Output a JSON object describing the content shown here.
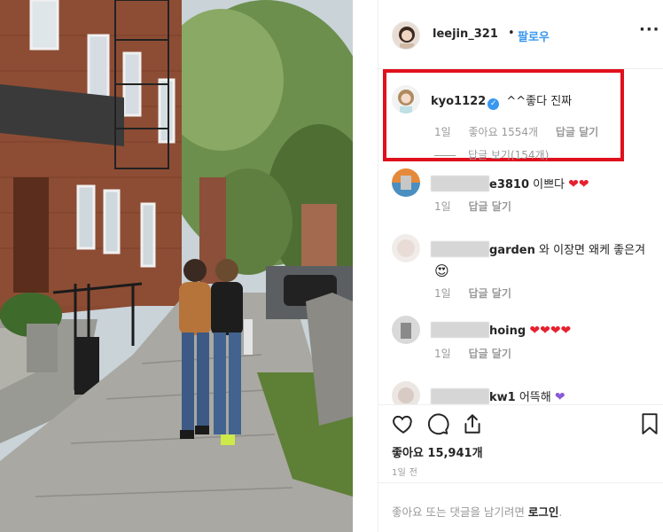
{
  "post": {
    "username": "leejin_321",
    "separator": "•",
    "follow_label": "팔로우",
    "more_icon": "more-dots-icon"
  },
  "comments": [
    {
      "username": "kyo1122",
      "verified": true,
      "text": "^^좋다 진짜",
      "time": "1일",
      "likes": "좋아요 1554개",
      "reply_label": "답글 달기",
      "view_replies": "답글 보기(154개)",
      "highlighted": true
    },
    {
      "username_suffix": "e3810",
      "text": "이쁘다",
      "time": "1일",
      "reply_label": "답글 달기"
    },
    {
      "username_suffix": "garden",
      "text": "와 이장면 왜케 좋은겨",
      "time": "1일",
      "reply_label": "답글 달기"
    },
    {
      "username_suffix": "hoing",
      "time": "1일",
      "reply_label": "답글 달기"
    },
    {
      "username_suffix": "kw1",
      "text": "어뜩해"
    }
  ],
  "actions": {
    "likes_count": "좋아요 15,941개",
    "time": "1일 전"
  },
  "login_bar": {
    "prefix": "좋아요 또는 댓글을 남기려면 ",
    "link": "로그인",
    "suffix": "."
  },
  "colors": {
    "accent": "#3897f0",
    "highlight_border": "#e0101c",
    "heart": "#e6202f"
  }
}
